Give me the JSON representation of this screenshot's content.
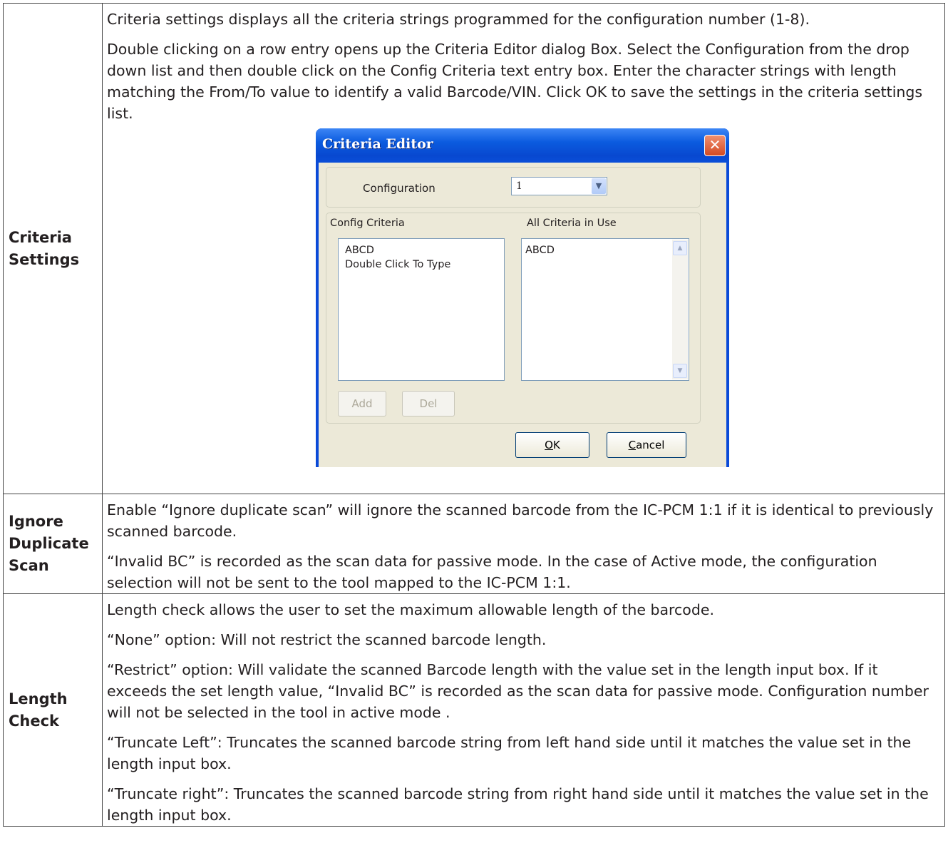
{
  "rows": [
    {
      "label": [
        "Criteria",
        "Settings"
      ],
      "paragraphs": [
        "Criteria settings displays all the criteria strings programmed for the configuration number (1-8).",
        "Double clicking on a row entry opens up the Criteria Editor dialog Box. Select the Configuration from the drop down list and then double click on the Config Criteria text entry box. Enter the character strings with length matching the From/To value to identify a valid Barcode/VIN.  Click OK to save the settings in the criteria settings list."
      ]
    },
    {
      "label": [
        "Ignore",
        "Duplicate",
        "Scan"
      ],
      "paragraphs": [
        "Enable “Ignore duplicate scan” will ignore the scanned barcode from the IC-PCM 1:1  if it is identical to previously scanned barcode.",
        "“Invalid BC” is recorded as the scan data for passive mode. In the case of Active mode, the configuration selection will not be sent to the tool mapped to the IC-PCM 1:1."
      ]
    },
    {
      "label": [
        "Length",
        "Check"
      ],
      "paragraphs": [
        "Length check allows the user to set the maximum allowable length of the barcode.",
        "“None” option: Will not restrict the scanned barcode length.",
        "“Restrict” option: Will validate the scanned Barcode length with the value set in the length input box. If it exceeds the set length value, “Invalid BC” is recorded as the scan data for passive mode. Configuration number will not be selected in the  tool in active mode .",
        "“Truncate Left”: Truncates the scanned barcode string from left hand side until it matches the value set in the length input box.",
        "“Truncate right”: Truncates the scanned barcode string from right hand side until it matches the value set in the length input box."
      ]
    }
  ],
  "dialog": {
    "title": "Criteria Editor",
    "close_icon": "close-icon",
    "configuration_label": "Configuration",
    "configuration_value": "1",
    "config_criteria_label": "Config Criteria",
    "all_criteria_label": "All Criteria in Use",
    "config_criteria_items": [
      "ABCD",
      "Double Click To Type"
    ],
    "all_criteria_items": [
      "ABCD"
    ],
    "add_button": "Add",
    "del_button": "Del",
    "ok_button": {
      "mnemonic": "O",
      "rest": "K"
    },
    "cancel_button": {
      "mnemonic": "C",
      "rest": "ancel"
    }
  }
}
